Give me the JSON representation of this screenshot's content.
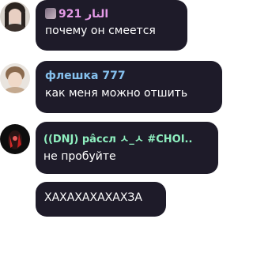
{
  "messages": [
    {
      "sender": "921 النار",
      "sender_color": "#e59be8",
      "text": "почему он смеется",
      "has_avatar": true,
      "has_badge": true
    },
    {
      "sender": "флешка 777",
      "sender_color": "#86c1ee",
      "text": "как меня можно отшить",
      "has_avatar": true,
      "has_badge": false
    },
    {
      "sender": "((DNJ) pâccл ㅅ_ㅅ #CHOI..",
      "sender_color": "#8ff0c0",
      "text": "не пробуйте",
      "has_avatar": true,
      "has_badge": false
    },
    {
      "sender": "",
      "sender_color": "",
      "text": "ХАХАХАХАХАХЗА",
      "has_avatar": false,
      "has_badge": false
    }
  ],
  "colors": {
    "bubble_bg": "#1e1b29",
    "text": "#ffffff",
    "page_bg": "#ffffff"
  }
}
